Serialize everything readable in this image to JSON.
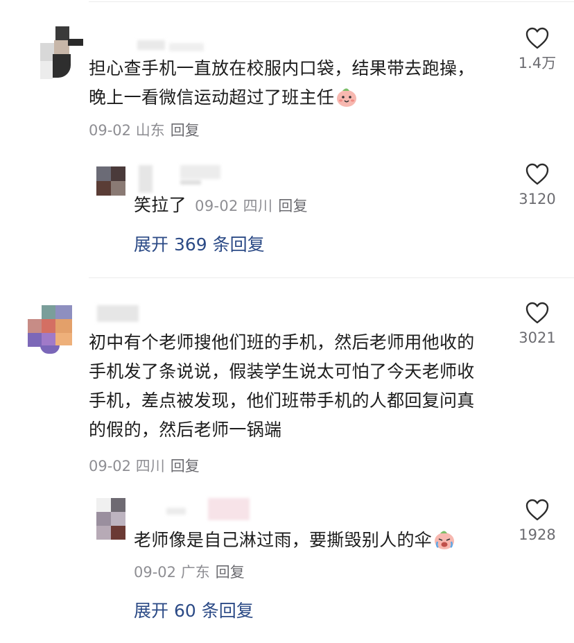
{
  "comments": [
    {
      "text": "担心查手机一直放在校服内口袋，结果带去跑操，晚上一看微信运动超过了班主任",
      "meta": "09-02 山东",
      "reply_label": "回复",
      "likes": "1.4万",
      "emoji": "smile-face-icon",
      "replies": [
        {
          "text": "笑拉了",
          "meta": "09-02 四川",
          "reply_label": "回复",
          "likes": "3120",
          "expand_label": "展开 369 条回复"
        }
      ]
    },
    {
      "text": "初中有个老师搜他们班的手机，然后老师用他收的手机发了条说说，假装学生说太可怕了今天老师收手机，差点被发现，他们班带手机的人都回复问真的假的，然后老师一锅端",
      "meta": "09-02 四川",
      "reply_label": "回复",
      "likes": "3021",
      "replies": [
        {
          "text": "老师像是自己淋过雨，要撕毁别人的伞",
          "meta": "09-02 广东",
          "reply_label": "回复",
          "likes": "1928",
          "emoji": "crying-face-icon",
          "expand_label": "展开 60 条回复"
        }
      ]
    }
  ],
  "colors": {
    "link": "#2b4a86",
    "meta": "#8e8e93",
    "text": "#1c1c1c"
  }
}
